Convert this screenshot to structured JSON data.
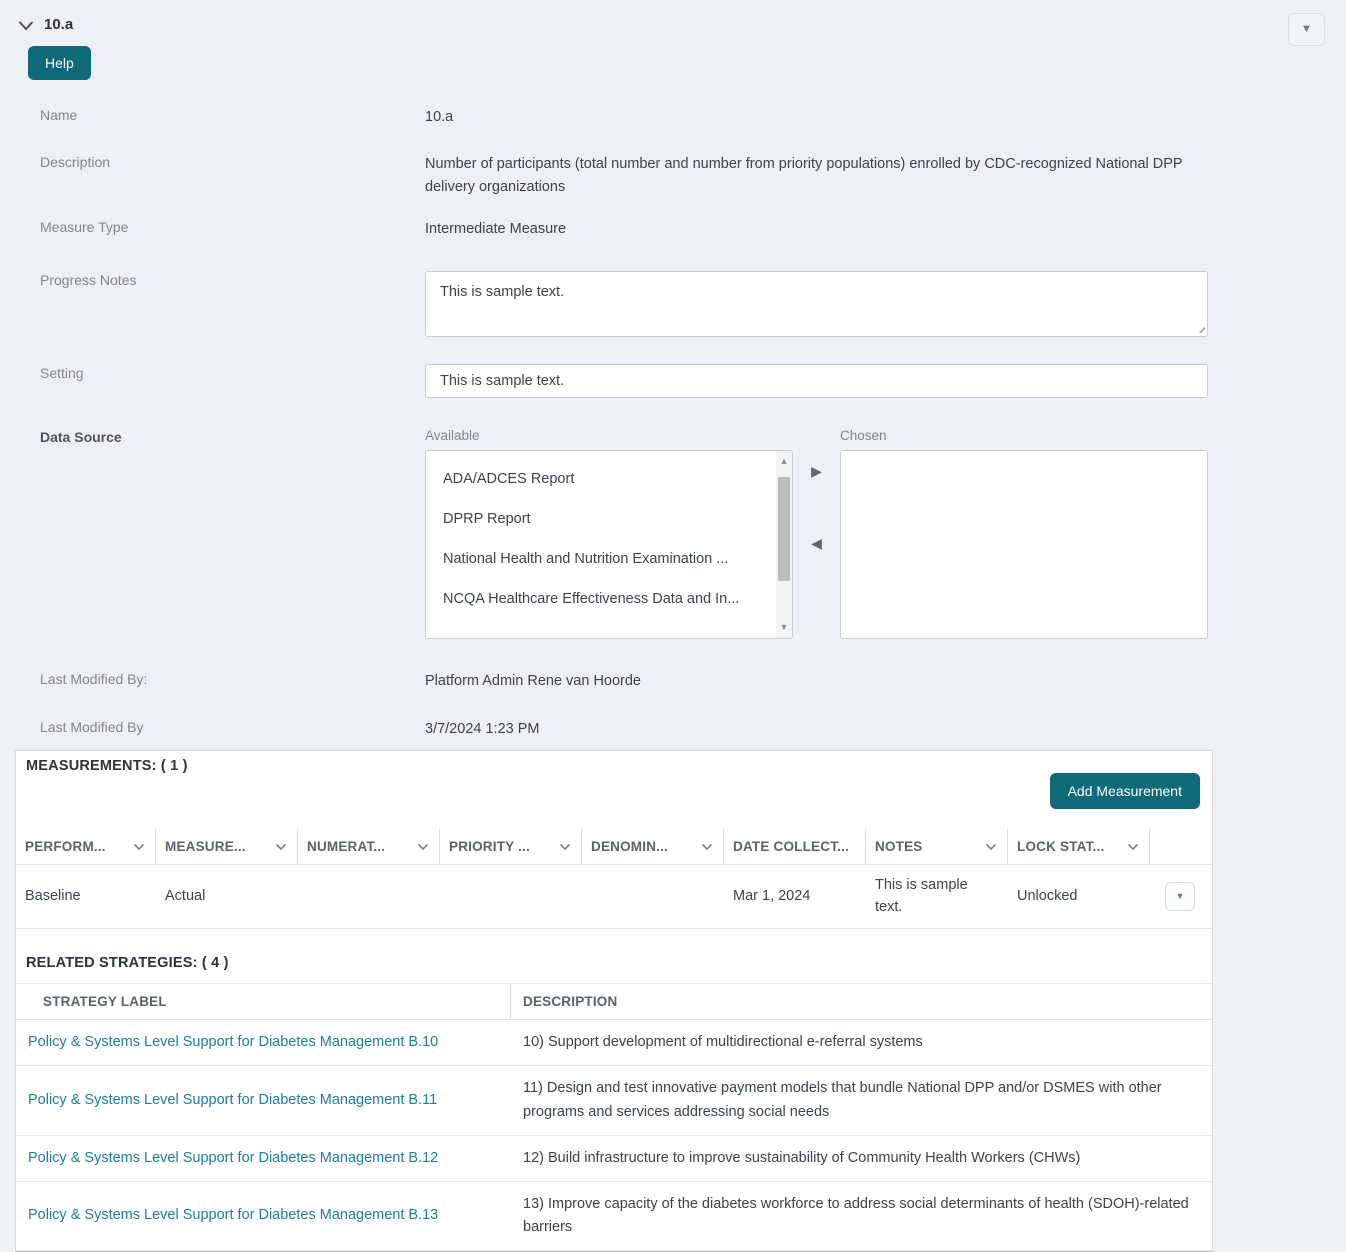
{
  "colors": {
    "accent_teal": "#0e6a79",
    "link_teal": "#1d7e9c",
    "page_bg": "#edf1f5"
  },
  "header": {
    "title": "10.a",
    "help_label": "Help"
  },
  "form": {
    "name": {
      "label": "Name",
      "value": "10.a"
    },
    "description": {
      "label": "Description",
      "value": "Number of participants (total number and number from priority populations) enrolled by CDC-recognized National DPP delivery organizations"
    },
    "measure_type": {
      "label": "Measure Type",
      "value": "Intermediate Measure"
    },
    "progress_notes": {
      "label": "Progress Notes",
      "value": "This is sample text."
    },
    "setting": {
      "label": "Setting",
      "value": "This is sample text."
    },
    "data_source": {
      "label": "Data Source",
      "available_label": "Available",
      "chosen_label": "Chosen",
      "available_items": [
        "ADA/ADCES Report",
        "DPRP Report",
        "National Health and Nutrition Examination ...",
        "NCQA Healthcare Effectiveness Data and In..."
      ],
      "chosen_items": []
    },
    "last_modified_by_user": {
      "label": "Last Modified By:",
      "value": "Platform Admin Rene van Hoorde"
    },
    "last_modified_by_date": {
      "label": "Last Modified By",
      "value": "3/7/2024 1:23 PM"
    }
  },
  "measurements": {
    "title": "MEASUREMENTS: ( 1 )",
    "add_button_label": "Add Measurement",
    "columns": [
      "PERFORM...",
      "MEASURE...",
      "NUMERAT...",
      "PRIORITY ...",
      "DENOMIN...",
      "DATE COLLECT...",
      "NOTES",
      "LOCK STAT..."
    ],
    "row": {
      "performance_period": "Baseline",
      "measurement_type": "Actual",
      "numerator": "",
      "priority_population": "",
      "denominator": "",
      "date_collected": "Mar 1, 2024",
      "notes": "This is sample text.",
      "lock_status": "Unlocked"
    }
  },
  "related_strategies": {
    "title": "RELATED STRATEGIES: ( 4 )",
    "columns": {
      "label": "STRATEGY LABEL",
      "description": "DESCRIPTION"
    },
    "rows": [
      {
        "label": "Policy & Systems Level Support for Diabetes Management B.10",
        "description": "10) Support development of multidirectional e-referral systems"
      },
      {
        "label": "Policy & Systems Level Support for Diabetes Management B.11",
        "description": "11) Design and test innovative payment models that bundle National DPP and/or DSMES with other programs and services addressing social needs"
      },
      {
        "label": "Policy & Systems Level Support for Diabetes Management B.12",
        "description": "12) Build infrastructure to improve sustainability of Community Health Workers (CHWs)"
      },
      {
        "label": "Policy & Systems Level Support for Diabetes Management B.13",
        "description": "13) Improve capacity of the diabetes workforce to address social determinants of health (SDOH)-related barriers"
      }
    ]
  }
}
